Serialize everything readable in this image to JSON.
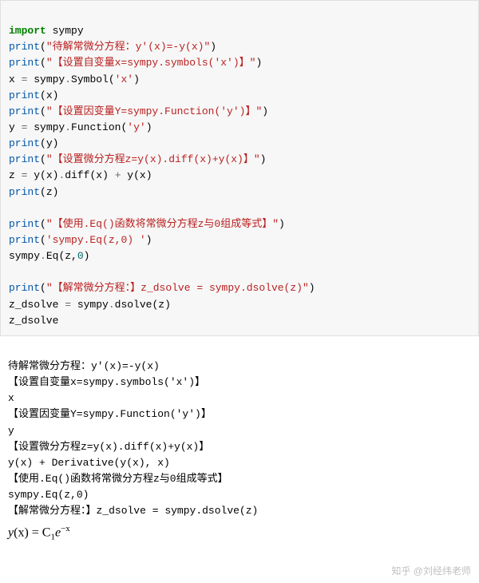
{
  "code": {
    "l1_kw": "import",
    "l1_mod": " sympy",
    "l2_fn": "print",
    "l2_p1": "(",
    "l2_str": "\"待解常微分方程：y'(x)=-y(x)\"",
    "l2_p2": ")",
    "l3_fn": "print",
    "l3_p1": "(",
    "l3_str": "\"【设置自变量x=sympy.symbols('x')】\"",
    "l3_p2": ")",
    "l4_lhs": "x ",
    "l4_op": "=",
    "l4_mid": " sympy",
    "l4_dot": ".",
    "l4_fn": "Symbol",
    "l4_p1": "(",
    "l4_arg": "'x'",
    "l4_p2": ")",
    "l5_fn": "print",
    "l5_p1": "(",
    "l5_arg": "x",
    "l5_p2": ")",
    "l6_fn": "print",
    "l6_p1": "(",
    "l6_str": "\"【设置因变量Y=sympy.Function('y')】\"",
    "l6_p2": ")",
    "l7_lhs": "y ",
    "l7_op": "=",
    "l7_mid": " sympy",
    "l7_dot": ".",
    "l7_fn": "Function",
    "l7_p1": "(",
    "l7_arg": "'y'",
    "l7_p2": ")",
    "l8_fn": "print",
    "l8_p1": "(",
    "l8_arg": "y",
    "l8_p2": ")",
    "l9_fn": "print",
    "l9_p1": "(",
    "l9_str": "\"【设置微分方程z=y(x).diff(x)+y(x)】\"",
    "l9_p2": ")",
    "l10_lhs": "z ",
    "l10_op1": "=",
    "l10_a": " y(x)",
    "l10_dot": ".",
    "l10_fn": "diff",
    "l10_b": "(x) ",
    "l10_op2": "+",
    "l10_c": " y(x)",
    "l11_fn": "print",
    "l11_p1": "(",
    "l11_arg": "z",
    "l11_p2": ")",
    "blank1": "",
    "l12_fn": "print",
    "l12_p1": "(",
    "l12_str": "\"【使用.Eq()函数将常微分方程z与0组成等式】\"",
    "l12_p2": ")",
    "l13_fn": "print",
    "l13_p1": "(",
    "l13_str": "'sympy.Eq(z,0) '",
    "l13_p2": ")",
    "l14_a": "sympy",
    "l14_dot": ".",
    "l14_fn": "Eq",
    "l14_p1": "(",
    "l14_arg1": "z,",
    "l14_arg2": "0",
    "l14_p2": ")",
    "blank2": "",
    "l15_fn": "print",
    "l15_p1": "(",
    "l15_str": "\"【解常微分方程：】z_dsolve = sympy.dsolve(z)\"",
    "l15_p2": ")",
    "l16_lhs": "z_dsolve ",
    "l16_op": "=",
    "l16_mid": " sympy",
    "l16_dot": ".",
    "l16_fn": "dsolve",
    "l16_p1": "(",
    "l16_arg": "z",
    "l16_p2": ")",
    "l17": "z_dsolve"
  },
  "output": {
    "o1": "待解常微分方程：y'(x)=-y(x)",
    "o2": "【设置自变量x=sympy.symbols('x')】",
    "o3": "x",
    "o4": "【设置因变量Y=sympy.Function('y')】",
    "o5": "y",
    "o6": "【设置微分方程z=y(x).diff(x)+y(x)】",
    "o7": "y(x) + Derivative(y(x), x)",
    "o8": "【使用.Eq()函数将常微分方程z与0组成等式】",
    "o9": "sympy.Eq(z,0) ",
    "o10": "【解常微分方程：】z_dsolve = sympy.dsolve(z)",
    "math_yx": "y",
    "math_px": "(x) = C",
    "math_sub": "1",
    "math_e": "e",
    "math_exp": "−x"
  },
  "watermark": "知乎 @刘经纬老师"
}
